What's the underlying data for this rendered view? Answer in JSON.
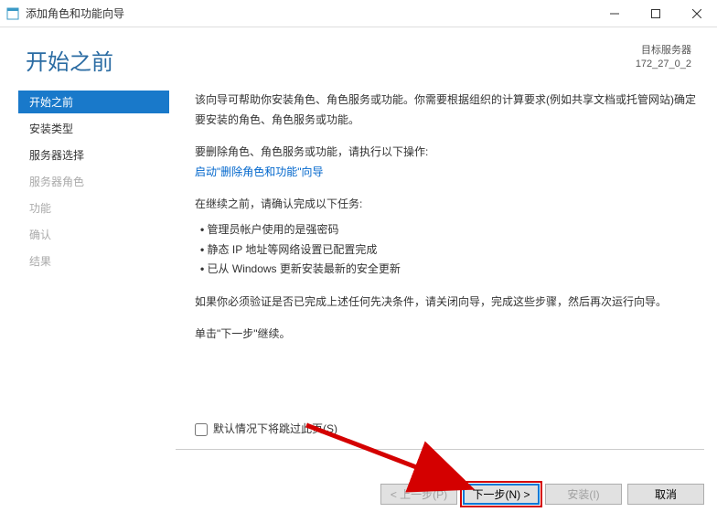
{
  "titlebar": {
    "title": "添加角色和功能向导"
  },
  "header": {
    "heading": "开始之前",
    "target_label": "目标服务器",
    "target_value": "172_27_0_2"
  },
  "sidebar": {
    "items": [
      {
        "label": "开始之前",
        "state": "active"
      },
      {
        "label": "安装类型",
        "state": "normal"
      },
      {
        "label": "服务器选择",
        "state": "normal"
      },
      {
        "label": "服务器角色",
        "state": "disabled"
      },
      {
        "label": "功能",
        "state": "disabled"
      },
      {
        "label": "确认",
        "state": "disabled"
      },
      {
        "label": "结果",
        "state": "disabled"
      }
    ]
  },
  "content": {
    "intro": "该向导可帮助你安装角色、角色服务或功能。你需要根据组织的计算要求(例如共享文档或托管网站)确定要安装的角色、角色服务或功能。",
    "remove_label": "要删除角色、角色服务或功能，请执行以下操作:",
    "remove_link": "启动\"删除角色和功能\"向导",
    "tasks_label": "在继续之前，请确认完成以下任务:",
    "tasks": [
      "管理员帐户使用的是强密码",
      "静态 IP 地址等网络设置已配置完成",
      "已从 Windows 更新安装最新的安全更新"
    ],
    "verify": "如果你必须验证是否已完成上述任何先决条件，请关闭向导，完成这些步骤，然后再次运行向导。",
    "continue": "单击\"下一步\"继续。",
    "skip_label": "默认情况下将跳过此页(S)"
  },
  "footer": {
    "prev": "< 上一步(P)",
    "next": "下一步(N) >",
    "install": "安装(I)",
    "cancel": "取消"
  }
}
